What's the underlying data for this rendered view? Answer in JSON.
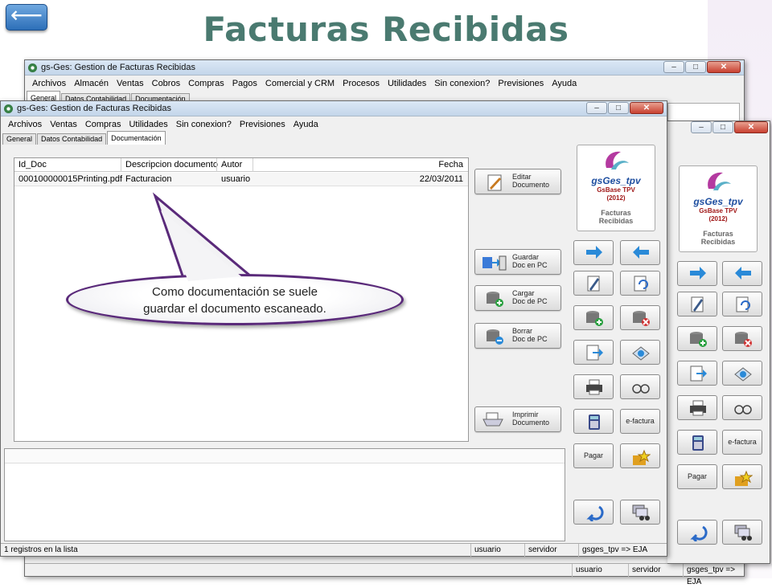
{
  "slide": {
    "title": "Facturas Recibidas",
    "back_glyph": "⟵"
  },
  "back_window": {
    "title": "gs-Ges: Gestion de Facturas Recibidas",
    "menu": [
      "Archivos",
      "Almacén",
      "Ventas",
      "Cobros",
      "Compras",
      "Pagos",
      "Comercial y CRM",
      "Procesos",
      "Utilidades",
      "Sin conexion?",
      "Previsiones",
      "Ayuda"
    ],
    "tabs": [
      "General",
      "Datos Contabilidad",
      "Documentación"
    ],
    "status": [
      "usuario",
      "servidor",
      "gsges_tpv => EJA"
    ],
    "logo": {
      "brand": "gsGes_tpv",
      "line1": "GsBase TPV",
      "line2": "(2012)",
      "line3": "Facturas",
      "line4": "Recibidas"
    },
    "epay_label": "e-factura",
    "pay_label": "Pagar"
  },
  "front_window": {
    "title": "gs-Ges: Gestion de Facturas Recibidas",
    "menu": [
      "Archivos",
      "Ventas",
      "Compras",
      "Utilidades",
      "Sin conexion?",
      "Previsiones",
      "Ayuda"
    ],
    "tabs": [
      "General",
      "Datos Contabilidad",
      "Documentación"
    ],
    "grid": {
      "columns": [
        "Id_Doc",
        "Descripcion documento",
        "Autor",
        "Fecha"
      ],
      "rows": [
        {
          "id": "000100000015Printing.pdf",
          "desc": "Facturacion",
          "autor": "usuario",
          "fecha": "22/03/2011"
        }
      ]
    },
    "buttons": {
      "edit": [
        "Editar",
        "Documento"
      ],
      "save": [
        "Guardar",
        "Doc en PC"
      ],
      "load": [
        "Cargar",
        "Doc de PC"
      ],
      "delete": [
        "Borrar",
        "Doc de PC"
      ],
      "print": [
        "Imprimir",
        "Documento"
      ]
    },
    "logo": {
      "brand": "gsGes_tpv",
      "line1": "GsBase TPV",
      "line2": "(2012)",
      "line3": "Facturas",
      "line4": "Recibidas"
    },
    "epay_label": "e-factura",
    "pay_label": "Pagar",
    "status": {
      "count": "1 registros en la lista",
      "user": "usuario",
      "server": "servidor",
      "db": "gsges_tpv => EJA"
    }
  },
  "callout": {
    "line1": "Como documentación se suele",
    "line2": "guardar el documento escaneado."
  },
  "colors": {
    "title": "#4a7a70",
    "callout_border": "#5a2a7a"
  }
}
